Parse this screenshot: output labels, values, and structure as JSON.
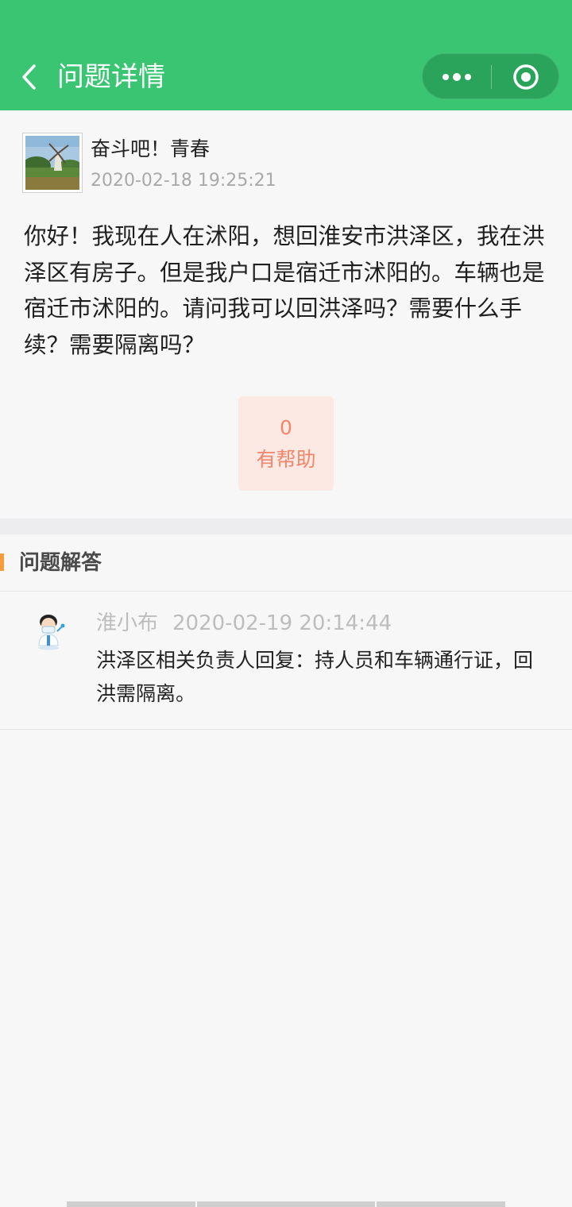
{
  "header": {
    "title": "问题详情",
    "background": "#39c572",
    "back_icon": "chevron-left-icon",
    "more_icon": "more-dots-icon",
    "close_icon": "target-circle-icon"
  },
  "question": {
    "user_name": "奋斗吧！青春",
    "time": "2020-02-18 19:25:21",
    "text": "你好！我现在人在沭阳，想回淮安市洪泽区，我在洪泽区有房子。但是我户口是宿迁市沭阳的。车辆也是宿迁市沭阳的。请问我可以回洪泽吗？需要什么手续？需要隔离吗？",
    "helpful_count": "0",
    "helpful_label": "有帮助"
  },
  "answers_section": {
    "title": "问题解答",
    "accent_color": "#fa9b3a"
  },
  "answers": [
    {
      "author": "淮小布",
      "time": "2020-02-19 20:14:44",
      "text": "洪泽区相关负责人回复：持人员和车辆通行证，回洪需隔离。"
    }
  ]
}
